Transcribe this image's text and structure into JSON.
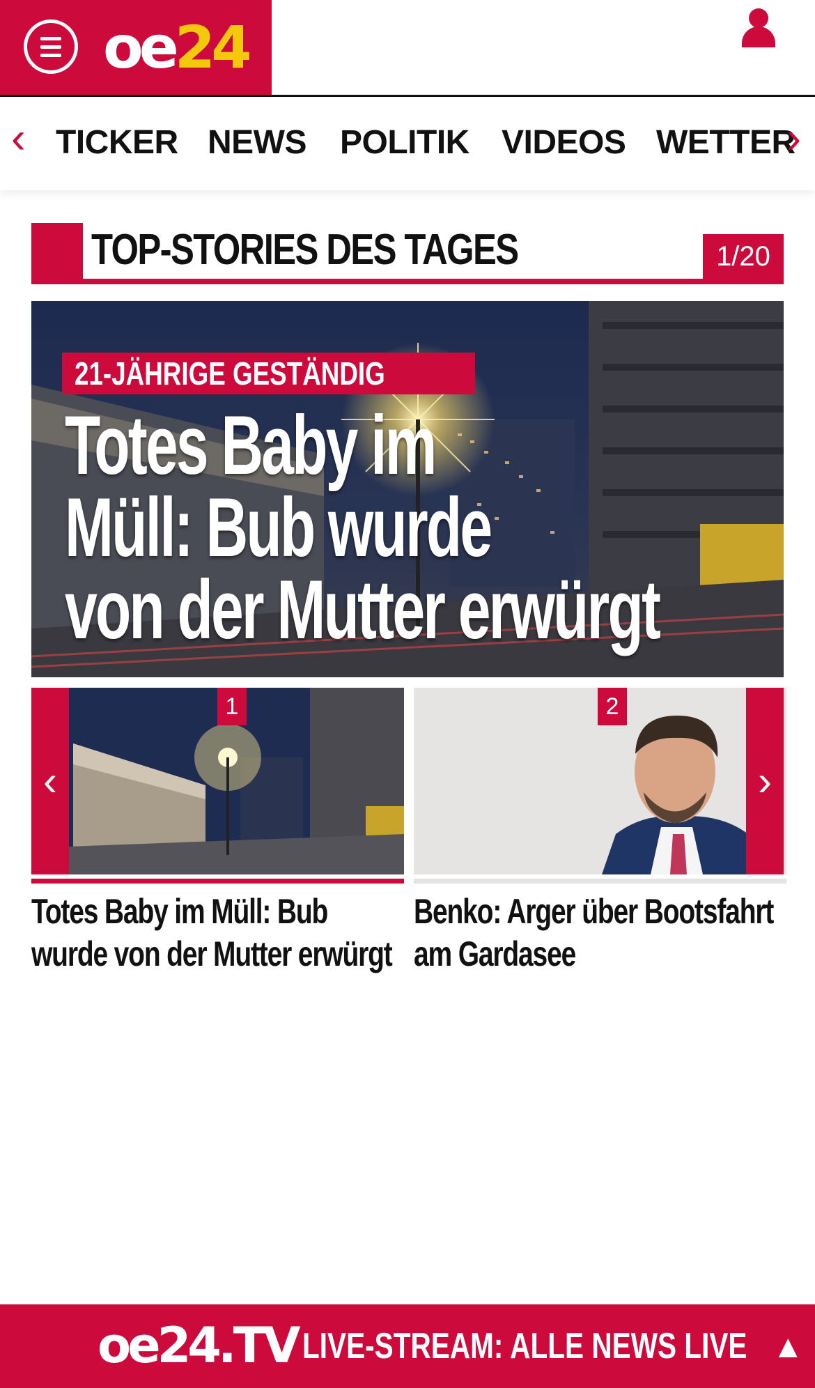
{
  "header": {
    "logo_main": "oe",
    "logo_number": "24",
    "menu_icon": "hamburger-menu-icon",
    "user_icon": "user-icon"
  },
  "nav": {
    "left_arrow": "‹",
    "right_arrow": "›",
    "items": [
      {
        "label": "TICKER"
      },
      {
        "label": "NEWS"
      },
      {
        "label": "POLITIK"
      },
      {
        "label": "VIDEOS"
      },
      {
        "label": "WETTER"
      }
    ]
  },
  "section": {
    "title": "TOP-STORIES DES TAGES",
    "counter": "1/20"
  },
  "hero": {
    "kicker": "21-JÄHRIGE GESTÄNDIG",
    "title_lines": [
      "Totes Baby im",
      "Müll: Bub wurde",
      "von der Mutter erwürgt"
    ]
  },
  "teasers": [
    {
      "number": "1",
      "title": "Totes Baby im Müll: Bub wurde von der Mutter erwürgt"
    },
    {
      "number": "2",
      "title": "Benko: Arger über Bootsfahrt am Gardasee"
    }
  ],
  "carousel": {
    "prev": "‹",
    "next": "›"
  },
  "footer": {
    "logo": "oe24.TV",
    "text": "LIVE-STREAM:  ALLE NEWS LIVE",
    "up_arrow": "▲"
  },
  "colors": {
    "brand_red": "#cc0a3b",
    "logo_yellow": "#f4c90d"
  }
}
